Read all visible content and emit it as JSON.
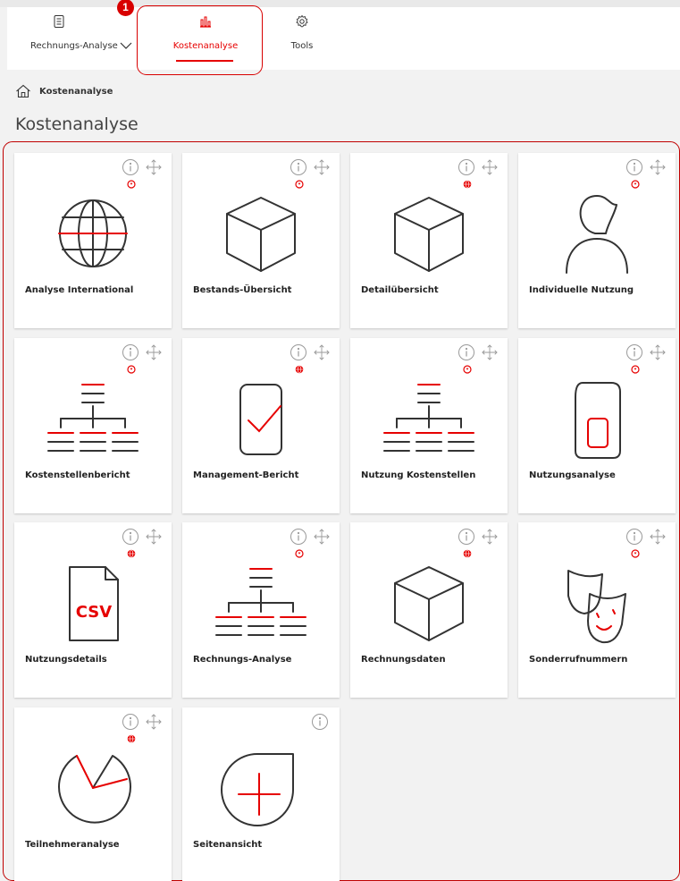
{
  "nav": {
    "items": [
      {
        "label": "Rechnungs-Analyse",
        "icon": "document-icon"
      },
      {
        "label": "Kostenanalyse",
        "icon": "chart-icon"
      },
      {
        "label": "Tools",
        "icon": "gear-icon"
      }
    ],
    "badge": "1"
  },
  "breadcrumb": {
    "label": "Kostenanalyse",
    "icon": "home-icon"
  },
  "page": {
    "title": "Kostenanalyse"
  },
  "colors": {
    "accent": "#e60000",
    "highlight": "#d80000",
    "icon_dark": "#333333",
    "background": "#f2f2f2"
  },
  "tiles": [
    {
      "label": "Analyse International",
      "icon": "globe-icon",
      "status": "refresh"
    },
    {
      "label": "Bestands-Übersicht",
      "icon": "box-icon",
      "status": "refresh"
    },
    {
      "label": "Detailübersicht",
      "icon": "box-icon",
      "status": "globe"
    },
    {
      "label": "Individuelle Nutzung",
      "icon": "user-icon",
      "status": "refresh"
    },
    {
      "label": "Kostenstellenbericht",
      "icon": "hierarchy-icon",
      "status": "refresh"
    },
    {
      "label": "Management-Bericht",
      "icon": "tablet-check-icon",
      "status": "globe"
    },
    {
      "label": "Nutzung Kostenstellen",
      "icon": "hierarchy-icon",
      "status": "refresh"
    },
    {
      "label": "Nutzungsanalyse",
      "icon": "sim-card-icon",
      "status": "refresh"
    },
    {
      "label": "Nutzungsdetails",
      "icon": "csv-file-icon",
      "status": "globe",
      "icon_text": "CSV"
    },
    {
      "label": "Rechnungs-Analyse",
      "icon": "hierarchy-icon",
      "status": "refresh"
    },
    {
      "label": "Rechnungsdaten",
      "icon": "box-icon",
      "status": "globe"
    },
    {
      "label": "Sonderrufnummern",
      "icon": "theater-masks-icon",
      "status": "refresh"
    },
    {
      "label": "Teilnehmeranalyse",
      "icon": "pie-chart-icon",
      "status": "globe"
    },
    {
      "label": "Seitenansicht",
      "icon": "add-page-icon",
      "status": "none"
    }
  ]
}
